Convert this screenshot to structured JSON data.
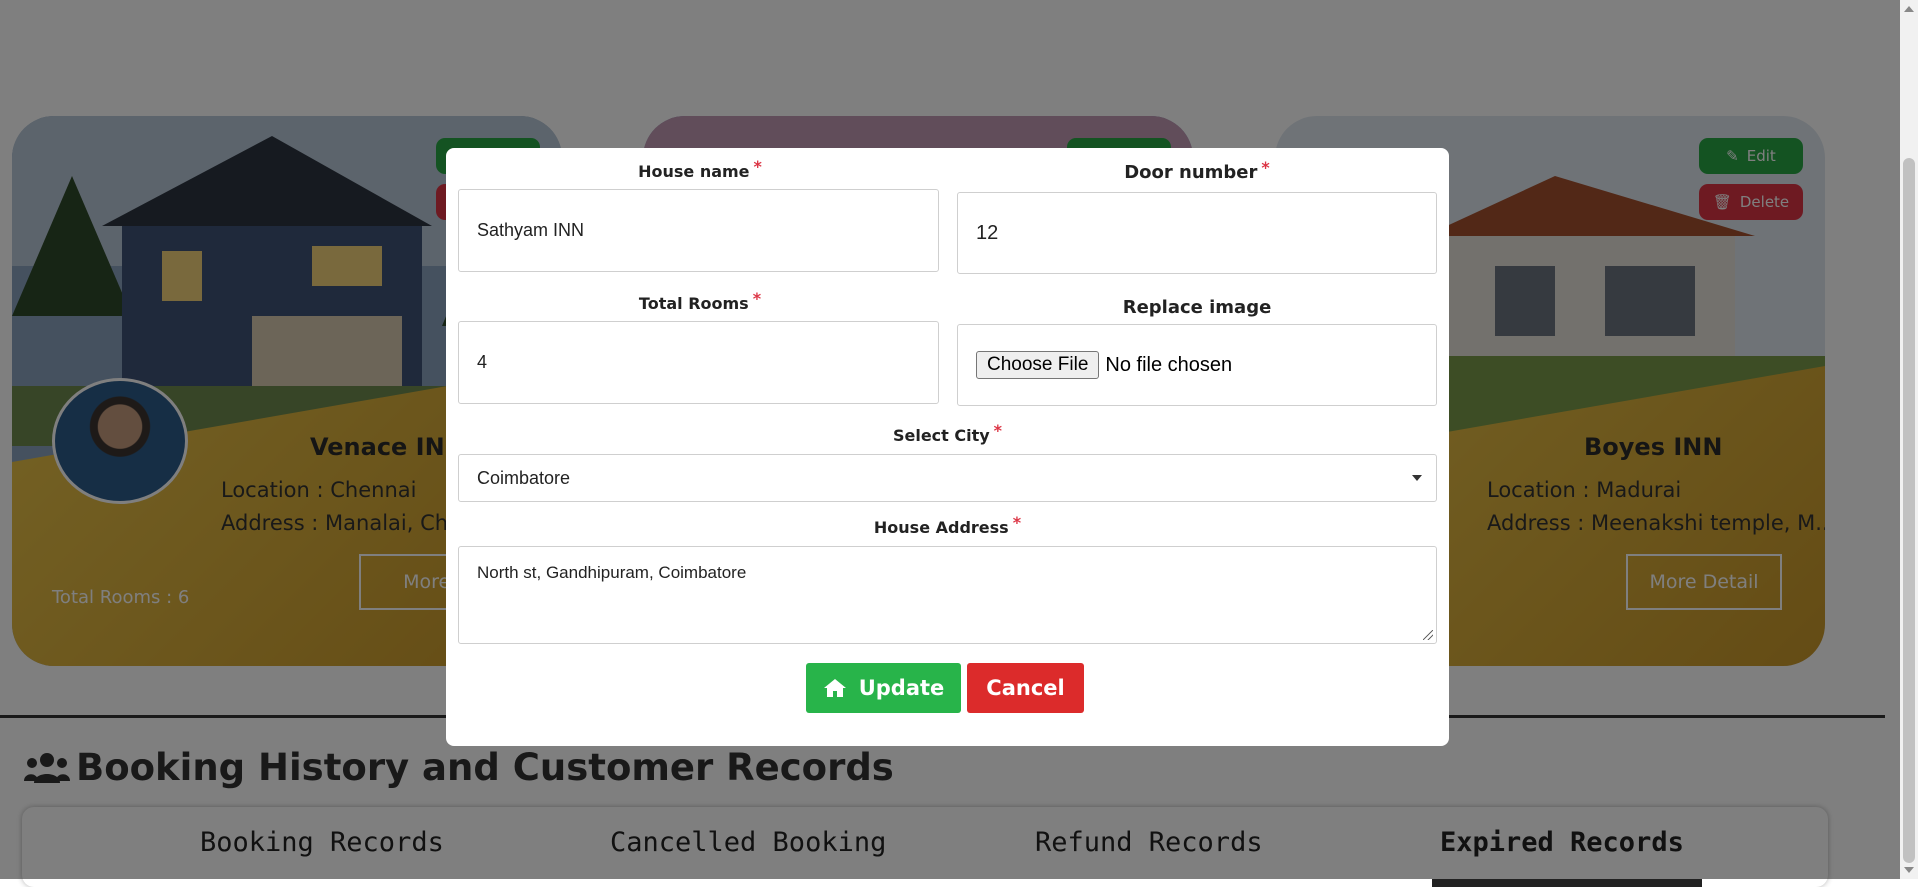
{
  "cards": [
    {
      "name": "Venace INN",
      "location": "Location : Chennai",
      "address": "Address : Manalai, Chen",
      "total_rooms": "Total Rooms : 6",
      "more_label": "More D"
    },
    {
      "name": "",
      "location": "",
      "address": "",
      "total_rooms": "",
      "more_label": ""
    },
    {
      "name": "Boyes INN",
      "location": "Location : Madurai",
      "address": "Address : Meenakshi temple, M...",
      "total_rooms": "",
      "more_label": "More Detail",
      "edit_label": "Edit",
      "delete_label": "Delete"
    }
  ],
  "section": {
    "title": "Booking History and Customer Records",
    "icon": "users-icon"
  },
  "tabs": [
    {
      "label": "Booking Records"
    },
    {
      "label": "Cancelled Booking"
    },
    {
      "label": "Refund Records"
    },
    {
      "label": "Expired Records",
      "active": true
    }
  ],
  "modal": {
    "house_name": {
      "label": "House name",
      "value": "Sathyam INN"
    },
    "door_number": {
      "label": "Door number",
      "value": "12"
    },
    "total_rooms": {
      "label": "Total Rooms",
      "value": "4"
    },
    "replace_image": {
      "label": "Replace image",
      "button": "Choose File",
      "status": "No file chosen"
    },
    "city": {
      "label": "Select City",
      "value": "Coimbatore"
    },
    "address": {
      "label": "House Address",
      "value": "North st, Gandhipuram, Coimbatore"
    },
    "update_label": "Update",
    "cancel_label": "Cancel",
    "required_mark": "*"
  },
  "colors": {
    "success": "#28a745",
    "danger": "#dc3545",
    "gold": "#d9b13a"
  }
}
